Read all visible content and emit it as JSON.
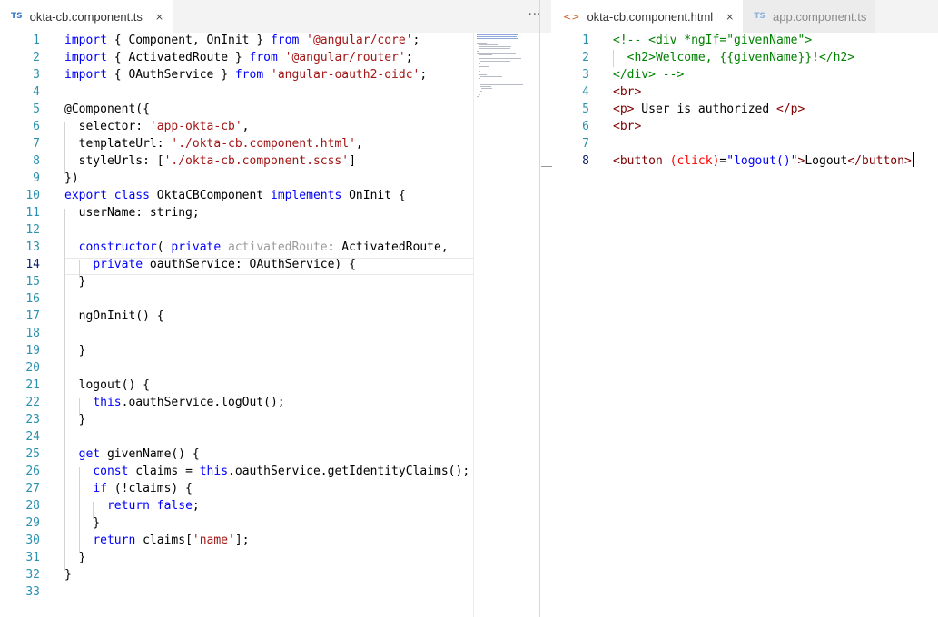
{
  "left_pane": {
    "tab": {
      "icon": "TS",
      "label": "okta-cb.component.ts",
      "close": "×"
    },
    "more": "···"
  },
  "right_pane": {
    "tabs": [
      {
        "icon": "<>",
        "label": "okta-cb.component.html",
        "close": "×"
      },
      {
        "icon": "TS",
        "label": "app.component.ts"
      }
    ]
  },
  "editor_left": {
    "language": "typescript",
    "current_line": 14,
    "lines": [
      {
        "n": "1",
        "text": "import { Component, OnInit } from '@angular/core';"
      },
      {
        "n": "2",
        "text": "import { ActivatedRoute } from '@angular/router';"
      },
      {
        "n": "3",
        "text": "import { OAuthService } from 'angular-oauth2-oidc';"
      },
      {
        "n": "4",
        "text": ""
      },
      {
        "n": "5",
        "text": "@Component({"
      },
      {
        "n": "6",
        "text": "  selector: 'app-okta-cb',"
      },
      {
        "n": "7",
        "text": "  templateUrl: './okta-cb.component.html',"
      },
      {
        "n": "8",
        "text": "  styleUrls: ['./okta-cb.component.scss']"
      },
      {
        "n": "9",
        "text": "})"
      },
      {
        "n": "10",
        "text": "export class OktaCBComponent implements OnInit {"
      },
      {
        "n": "11",
        "text": "  userName: string;"
      },
      {
        "n": "12",
        "text": ""
      },
      {
        "n": "13",
        "text": "  constructor( private activatedRoute: ActivatedRoute,"
      },
      {
        "n": "14",
        "text": "    private oauthService: OAuthService) {"
      },
      {
        "n": "15",
        "text": "  }"
      },
      {
        "n": "16",
        "text": ""
      },
      {
        "n": "17",
        "text": "  ngOnInit() {"
      },
      {
        "n": "18",
        "text": ""
      },
      {
        "n": "19",
        "text": "  }"
      },
      {
        "n": "20",
        "text": ""
      },
      {
        "n": "21",
        "text": "  logout() {"
      },
      {
        "n": "22",
        "text": "    this.oauthService.logOut();"
      },
      {
        "n": "23",
        "text": "  }"
      },
      {
        "n": "24",
        "text": ""
      },
      {
        "n": "25",
        "text": "  get givenName() {"
      },
      {
        "n": "26",
        "text": "    const claims = this.oauthService.getIdentityClaims();"
      },
      {
        "n": "27",
        "text": "    if (!claims) {"
      },
      {
        "n": "28",
        "text": "      return false;"
      },
      {
        "n": "29",
        "text": "    }"
      },
      {
        "n": "30",
        "text": "    return claims['name'];"
      },
      {
        "n": "31",
        "text": "  }"
      },
      {
        "n": "32",
        "text": "}"
      },
      {
        "n": "33",
        "text": ""
      }
    ]
  },
  "editor_right": {
    "language": "html",
    "current_line": 8,
    "lines": [
      {
        "n": "1",
        "text": "<!-- <div *ngIf=\"givenName\">"
      },
      {
        "n": "2",
        "text": "  <h2>Welcome, {{givenName}}!</h2>"
      },
      {
        "n": "3",
        "text": "</div> -->"
      },
      {
        "n": "4",
        "text": "<br>"
      },
      {
        "n": "5",
        "text": "<p> User is authorized </p>"
      },
      {
        "n": "6",
        "text": "<br>"
      },
      {
        "n": "7",
        "text": ""
      },
      {
        "n": "8",
        "text": "<button (click)=\"logout()\">Logout</button>"
      }
    ]
  },
  "colors": {
    "keyword": "#0000ff",
    "string": "#a31515",
    "comment": "#008000",
    "tag": "#800000",
    "attribute": "#ff0000",
    "line_number": "#2b91af"
  }
}
